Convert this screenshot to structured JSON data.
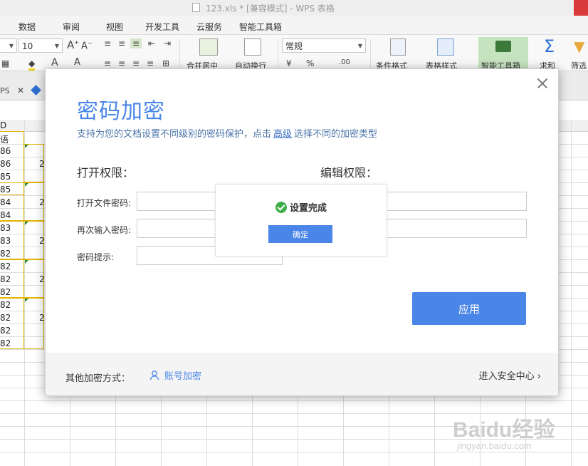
{
  "window": {
    "title": "123.xls * [兼容模式] - WPS 表格"
  },
  "menu": {
    "items": [
      "数据",
      "审阅",
      "视图",
      "开发工具",
      "云服务",
      "智能工具箱"
    ]
  },
  "ribbon": {
    "font_size": "10",
    "number_format": "常规",
    "labels": {
      "merge": "合并居中",
      "wrap": "自动换行",
      "cond_format": "条件格式",
      "table_style": "表格样式",
      "smart_tools": "智能工具箱",
      "sum": "求和",
      "filter": "筛选"
    }
  },
  "tabs": {
    "wps_label": "PS"
  },
  "sheet": {
    "column_header": "D",
    "cells": [
      "语",
      "86",
      "86",
      "85",
      "85",
      "84",
      "84",
      "83",
      "83",
      "82",
      "82",
      "82",
      "82",
      "82",
      "82",
      "82",
      "82"
    ],
    "col_b_values": [
      "2",
      "2",
      "2",
      "2",
      "2"
    ]
  },
  "dialog": {
    "title": "密码加密",
    "subtitle_before": "支持为您的文档设置不同级别的密码保护，点击",
    "subtitle_link": "高级",
    "subtitle_after": "选择不同的加密类型",
    "open_section": "打开权限：",
    "edit_section": "编辑权限：",
    "open_password_label": "打开文件密码:",
    "reenter_password_label": "再次输入密码:",
    "hint_label": "密码提示:",
    "apply_label": "应用",
    "footer": {
      "other_label": "其他加密方式：",
      "account_link": "账号加密",
      "security_center": "进入安全中心"
    }
  },
  "toast": {
    "message": "设置完成",
    "ok_label": "确定"
  },
  "watermark": {
    "brand": "Baidu经验",
    "url": "jingyan.baidu.com"
  },
  "colors": {
    "accent": "#4a86e8",
    "success": "#3fae4a",
    "highlight": "#e0b400"
  }
}
